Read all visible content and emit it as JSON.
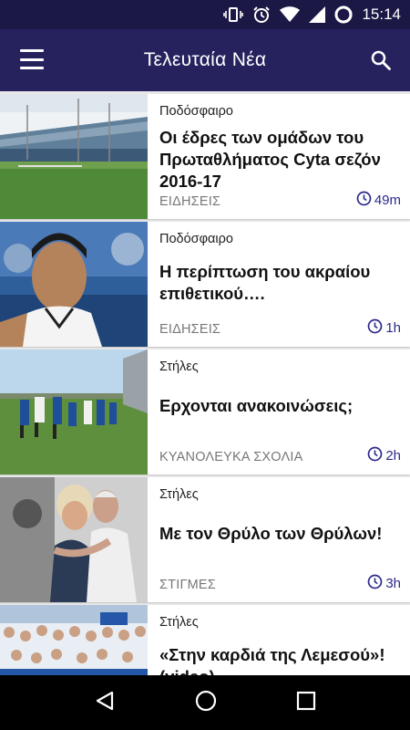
{
  "status_bar": {
    "time": "15:14"
  },
  "app_bar": {
    "title": "Τελευταία Νέα"
  },
  "articles": [
    {
      "category": "Ποδόσφαιρο",
      "headline": "Οι έδρες των ομάδων του Πρωταθλήματος Cyta σεζόν 2016-17",
      "section": "ΕΙΔΗΣΕΙΣ",
      "time": "49m"
    },
    {
      "category": "Ποδόσφαιρο",
      "headline": "Η περίπτωση του ακραίου επιθετικού….",
      "section": "ΕΙΔΗΣΕΙΣ",
      "time": "1h"
    },
    {
      "category": "Στήλες",
      "headline": "Ερχονται ανακοινώσεις;",
      "section": "ΚΥΑΝΟΛΕΥΚΑ ΣΧΟΛΙΑ",
      "time": "2h"
    },
    {
      "category": "Στήλες",
      "headline": "Με τον Θρύλο των Θρύλων!",
      "section": "ΣΤΙΓΜΕΣ",
      "time": "3h"
    },
    {
      "category": "Στήλες",
      "headline": "«Στην καρδιά της Λεμεσού»! (video)",
      "section": "",
      "time": ""
    }
  ],
  "colors": {
    "status_bar": "#1b1846",
    "app_bar": "#26225e",
    "time_accent": "#2a2a8a"
  }
}
